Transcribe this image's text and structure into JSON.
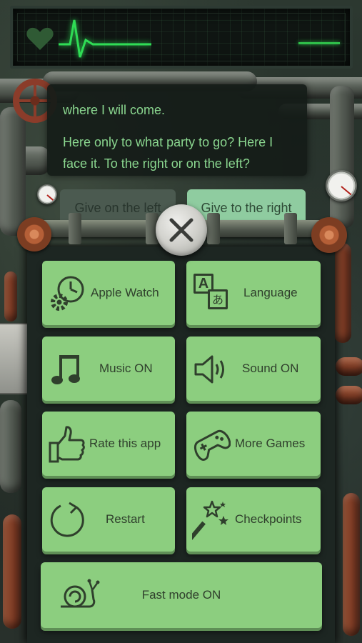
{
  "monitor": {
    "heart_icon": "heart-icon",
    "pulse_icon": "heartbeat-line"
  },
  "story": {
    "prev_line": "where I will come.",
    "main_line": "Here only to what party to go? Here I face it. To the right or on the left?"
  },
  "choices": {
    "left": "Give on the left",
    "right": "Give to the right"
  },
  "close_icon": "close-icon",
  "menu": {
    "apple_watch": "Apple Watch",
    "language": "Language",
    "music": "Music ON",
    "sound": "Sound ON",
    "rate": "Rate this app",
    "more_games": "More Games",
    "restart": "Restart",
    "checkpoints": "Checkpoints",
    "fast_mode": "Fast mode ON",
    "language_glyphs": {
      "latin": "A",
      "japanese": "あ"
    }
  },
  "colors": {
    "tile": "#8cce7f",
    "tile_text": "#2f3f2c",
    "story_text": "#8ad68f",
    "pulse": "#2fbf4a"
  }
}
